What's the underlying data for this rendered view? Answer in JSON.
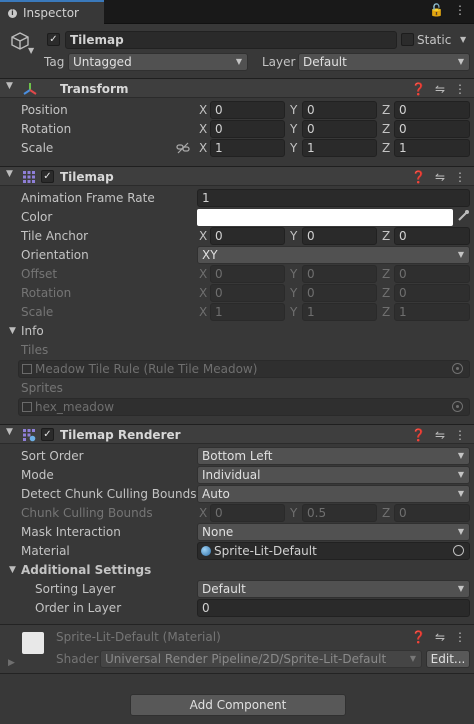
{
  "tab": {
    "label": "Inspector"
  },
  "object": {
    "name": "Tilemap",
    "static_label": "Static",
    "tag_label": "Tag",
    "tag_value": "Untagged",
    "layer_label": "Layer",
    "layer_value": "Default"
  },
  "transform": {
    "title": "Transform",
    "rows": [
      {
        "label": "Position",
        "x": "0",
        "y": "0",
        "z": "0"
      },
      {
        "label": "Rotation",
        "x": "0",
        "y": "0",
        "z": "0"
      },
      {
        "label": "Scale",
        "x": "1",
        "y": "1",
        "z": "1"
      }
    ]
  },
  "axis": {
    "x": "X",
    "y": "Y",
    "z": "Z"
  },
  "tilemap": {
    "title": "Tilemap",
    "animation_frame_rate_label": "Animation Frame Rate",
    "animation_frame_rate": "1",
    "color_label": "Color",
    "tile_anchor_label": "Tile Anchor",
    "tile_anchor": {
      "x": "0",
      "y": "0",
      "z": "0"
    },
    "orientation_label": "Orientation",
    "orientation": "XY",
    "offset_label": "Offset",
    "offset": {
      "x": "0",
      "y": "0",
      "z": "0"
    },
    "rotation_label": "Rotation",
    "rotation": {
      "x": "0",
      "y": "0",
      "z": "0"
    },
    "scale_label": "Scale",
    "scale": {
      "x": "1",
      "y": "1",
      "z": "1"
    },
    "info_label": "Info",
    "tiles_label": "Tiles",
    "tiles_value": "Meadow Tile Rule (Rule Tile Meadow)",
    "sprites_label": "Sprites",
    "sprites_value": "hex_meadow"
  },
  "renderer": {
    "title": "Tilemap Renderer",
    "sort_order_label": "Sort Order",
    "sort_order": "Bottom Left",
    "mode_label": "Mode",
    "mode": "Individual",
    "detect_label": "Detect Chunk Culling Bounds",
    "detect": "Auto",
    "chunk_label": "Chunk Culling Bounds",
    "chunk": {
      "x": "0",
      "y": "0.5",
      "z": "0"
    },
    "mask_label": "Mask Interaction",
    "mask": "None",
    "material_label": "Material",
    "material": "Sprite-Lit-Default",
    "additional_label": "Additional Settings",
    "sorting_layer_label": "Sorting Layer",
    "sorting_layer": "Default",
    "order_label": "Order in Layer",
    "order": "0"
  },
  "material_panel": {
    "title": "Sprite-Lit-Default (Material)",
    "shader_label": "Shader",
    "shader": "Universal Render Pipeline/2D/Sprite-Lit-Default",
    "edit_label": "Edit..."
  },
  "add_component": "Add Component",
  "colors": {
    "accent": "#3a79bb",
    "background": "#383838",
    "field": "#2a2a2a"
  }
}
